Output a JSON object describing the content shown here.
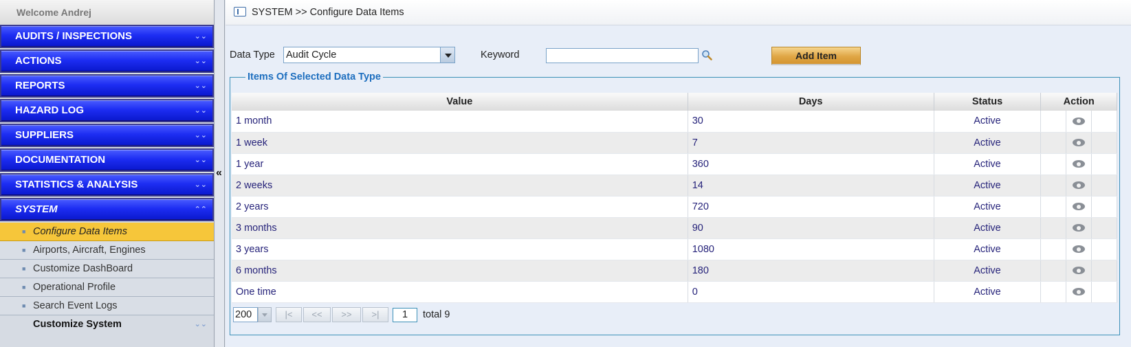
{
  "sidebar": {
    "welcome": "Welcome  Andrej",
    "menu": [
      {
        "label": "AUDITS / INSPECTIONS"
      },
      {
        "label": "ACTIONS"
      },
      {
        "label": "REPORTS"
      },
      {
        "label": "HAZARD LOG"
      },
      {
        "label": "SUPPLIERS"
      },
      {
        "label": "DOCUMENTATION"
      },
      {
        "label": "STATISTICS & ANALYSIS"
      },
      {
        "label": "SYSTEM"
      }
    ],
    "submenu": [
      {
        "label": "Configure Data Items"
      },
      {
        "label": "Airports, Aircraft, Engines"
      },
      {
        "label": "Customize DashBoard"
      },
      {
        "label": "Operational Profile"
      },
      {
        "label": "Search Event Logs"
      }
    ],
    "group_label": "Customize System"
  },
  "header": {
    "section": "SYSTEM",
    "separator": ">>",
    "page": "Configure Data Items"
  },
  "filters": {
    "data_type_label": "Data Type",
    "data_type_value": "Audit Cycle",
    "keyword_label": "Keyword",
    "keyword_value": "",
    "add_label": "Add Item"
  },
  "table": {
    "legend": "Items Of Selected Data Type",
    "headers": {
      "value": "Value",
      "days": "Days",
      "status": "Status",
      "action": "Action"
    },
    "rows": [
      {
        "value": "1 month",
        "days": "30",
        "status": "Active"
      },
      {
        "value": "1 week",
        "days": "7",
        "status": "Active"
      },
      {
        "value": "1 year",
        "days": "360",
        "status": "Active"
      },
      {
        "value": "2 weeks",
        "days": "14",
        "status": "Active"
      },
      {
        "value": "2 years",
        "days": "720",
        "status": "Active"
      },
      {
        "value": "3 months",
        "days": "90",
        "status": "Active"
      },
      {
        "value": "3 years",
        "days": "1080",
        "status": "Active"
      },
      {
        "value": "6 months",
        "days": "180",
        "status": "Active"
      },
      {
        "value": "One time",
        "days": "0",
        "status": "Active"
      }
    ]
  },
  "pager": {
    "page_size": "200",
    "first": "|<",
    "prev": "<<",
    "next": ">>",
    "last": ">|",
    "page": "1",
    "total": "total 9"
  },
  "icons": {
    "row_action": "eye-icon",
    "search": "search-icon",
    "collapse": "double-chevron-left-icon"
  }
}
